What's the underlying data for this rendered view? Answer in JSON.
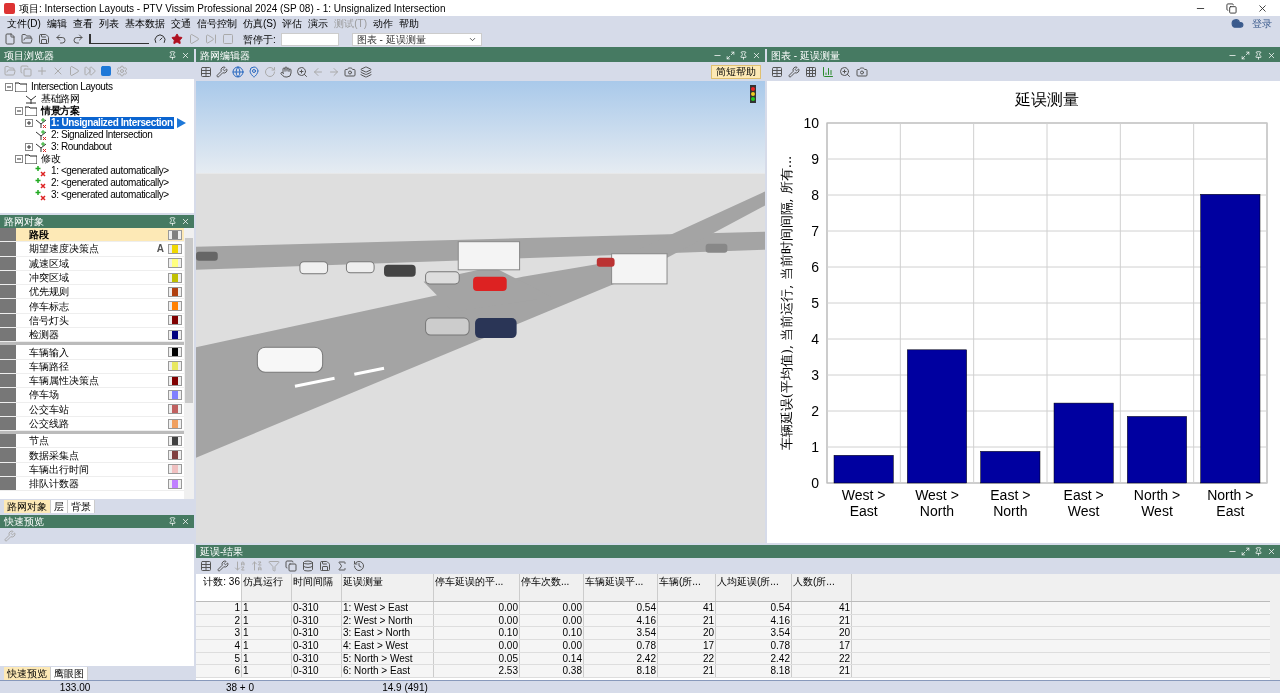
{
  "window": {
    "title": "项目: Intersection Layouts - PTV Vissim Professional 2024 (SP 08) - 1: Unsignalized Intersection"
  },
  "menu": [
    {
      "label": "文件(D)",
      "disabled": false
    },
    {
      "label": "编辑",
      "disabled": false
    },
    {
      "label": "查看",
      "disabled": false
    },
    {
      "label": "列表",
      "disabled": false
    },
    {
      "label": "基本数据",
      "disabled": false
    },
    {
      "label": "交通",
      "disabled": false
    },
    {
      "label": "信号控制",
      "disabled": false
    },
    {
      "label": "仿真(S)",
      "disabled": false
    },
    {
      "label": "评估",
      "disabled": false
    },
    {
      "label": "演示",
      "disabled": false
    },
    {
      "label": "测试(T)",
      "disabled": true
    },
    {
      "label": "动作",
      "disabled": false
    },
    {
      "label": "帮助",
      "disabled": false
    }
  ],
  "account": {
    "label": "登录"
  },
  "toolbar": {
    "speed_slider": {
      "level": 0
    },
    "pause_label": "暂停于:",
    "view_select": "图表 - 延误测量"
  },
  "project_browser": {
    "title": "项目浏览器",
    "tree": [
      {
        "label": "Intersection Layouts",
        "kind": "folder",
        "expanded": true,
        "selected": false,
        "active": false,
        "children": [
          {
            "label": "基础路网",
            "kind": "network",
            "selected": false,
            "active": false
          },
          {
            "label": "情景方案",
            "kind": "folder",
            "expanded": true,
            "selected": false,
            "active": true,
            "children": [
              {
                "label": "1: Unsignalized Intersection",
                "kind": "scenario",
                "expanded": false,
                "selected": true,
                "active": true
              },
              {
                "label": "2: Signalized Intersection",
                "kind": "scenario",
                "selected": false,
                "active": false
              },
              {
                "label": "3: Roundabout",
                "kind": "scenario",
                "expanded": false,
                "selected": false,
                "active": false
              }
            ]
          },
          {
            "label": "修改",
            "kind": "folder",
            "expanded": true,
            "selected": false,
            "active": false,
            "children": [
              {
                "label": "1: <generated automatically>",
                "kind": "modification",
                "selected": false,
                "active": false
              },
              {
                "label": "2: <generated automatically>",
                "kind": "modification",
                "selected": false,
                "active": false
              },
              {
                "label": "3: <generated automatically>",
                "kind": "modification",
                "selected": false,
                "active": false
              }
            ]
          }
        ]
      }
    ]
  },
  "network_objects": {
    "title": "路网对象",
    "groups": [
      {
        "items": [
          {
            "label": "路段",
            "selected": true,
            "color": "#808080"
          },
          {
            "label": "期望速度决策点",
            "selected": false,
            "color": "#f0d800",
            "badge": "A"
          },
          {
            "label": "减速区域",
            "selected": false,
            "color": "#ffff80"
          },
          {
            "label": "冲突区域",
            "selected": false,
            "color": "#c0c000"
          },
          {
            "label": "优先规则",
            "selected": false,
            "color": "#b04010"
          },
          {
            "label": "停车标志",
            "selected": false,
            "color": "#ff8000"
          },
          {
            "label": "信号灯头",
            "selected": false,
            "color": "#800000"
          },
          {
            "label": "检测器",
            "selected": false,
            "color": "#000080"
          }
        ]
      },
      {
        "items": [
          {
            "label": "车辆输入",
            "selected": false,
            "color": "#000000"
          },
          {
            "label": "车辆路径",
            "selected": false,
            "color": "#e8e860"
          },
          {
            "label": "车辆属性决策点",
            "selected": false,
            "color": "#800000"
          },
          {
            "label": "停车场",
            "selected": false,
            "color": "#8080ff"
          },
          {
            "label": "公交车站",
            "selected": false,
            "color": "#c06060"
          },
          {
            "label": "公交线路",
            "selected": false,
            "color": "#f0a060"
          }
        ]
      },
      {
        "items": [
          {
            "label": "节点",
            "selected": false,
            "color": "#404040"
          },
          {
            "label": "数据采集点",
            "selected": false,
            "color": "#804040"
          },
          {
            "label": "车辆出行时间",
            "selected": false,
            "color": "#f0c0c0"
          },
          {
            "label": "排队计数器",
            "selected": false,
            "color": "#c080ff"
          }
        ]
      }
    ],
    "tabs": [
      {
        "label": "路网对象",
        "selected": true
      },
      {
        "label": "层",
        "selected": false
      },
      {
        "label": "背景",
        "selected": false
      }
    ]
  },
  "quick_preview": {
    "title": "快速预览",
    "tabs": [
      {
        "label": "快速预览",
        "selected": true
      },
      {
        "label": "鹰眼图",
        "selected": false
      }
    ]
  },
  "network_editor": {
    "title": "路网编辑器",
    "help_button": "简短帮助"
  },
  "chart_panel": {
    "title": "图表 - 延误测量",
    "chart_data": {
      "type": "bar",
      "title": "延误测量",
      "ylabel": "车辆延误(平均值), 当前运行, 当前时间间隔, 所有...",
      "categories": [
        "West > East",
        "West > North",
        "East > North",
        "East > West",
        "North > West",
        "North > East"
      ],
      "grid": true,
      "series": [
        {
          "color": "#0000a0",
          "values": [
            0.77,
            3.7,
            0.88,
            2.22,
            1.85,
            8.02
          ]
        }
      ],
      "ylim": [
        0,
        10
      ],
      "yticks": [
        0,
        1,
        2,
        3,
        4,
        5,
        6,
        7,
        8,
        9,
        10
      ]
    }
  },
  "results": {
    "title": "延误-结果",
    "columns": [
      "计数: 36",
      "仿真运行",
      "时间间隔",
      "延误测量",
      "停车延误的平...",
      "停车次数...",
      "车辆延误平...",
      "车辆(所...",
      "人均延误(所...",
      "人数(所..."
    ],
    "rows": [
      [
        "1",
        "1",
        "0-310",
        "1: West > East",
        "0.00",
        "0.00",
        "0.54",
        "41",
        "0.54",
        "41"
      ],
      [
        "2",
        "1",
        "0-310",
        "2: West > North",
        "0.00",
        "0.00",
        "4.16",
        "21",
        "4.16",
        "21"
      ],
      [
        "3",
        "1",
        "0-310",
        "3: East > North",
        "0.10",
        "0.10",
        "3.54",
        "20",
        "3.54",
        "20"
      ],
      [
        "4",
        "1",
        "0-310",
        "4: East > West",
        "0.00",
        "0.00",
        "0.78",
        "17",
        "0.78",
        "17"
      ],
      [
        "5",
        "1",
        "0-310",
        "5: North > West",
        "0.05",
        "0.14",
        "2.42",
        "22",
        "2.42",
        "22"
      ],
      [
        "6",
        "1",
        "0-310",
        "6: North > East",
        "2.53",
        "0.38",
        "8.18",
        "21",
        "8.18",
        "21"
      ]
    ]
  },
  "status_bar": [
    "133.00",
    "38 + 0",
    "14.9 (491)"
  ]
}
